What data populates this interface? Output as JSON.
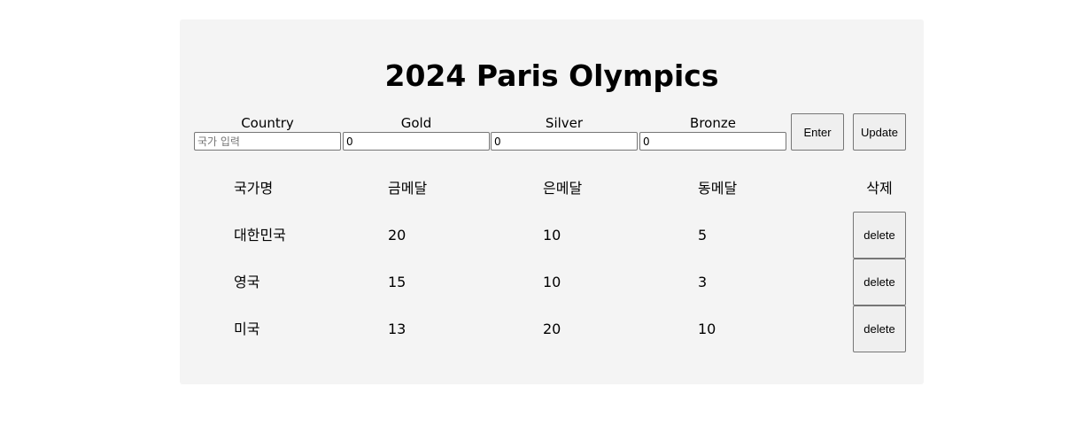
{
  "title": "2024 Paris Olympics",
  "form": {
    "country_label": "Country",
    "country_placeholder": "국가 입력",
    "country_value": "",
    "gold_label": "Gold",
    "gold_value": "0",
    "silver_label": "Silver",
    "silver_value": "0",
    "bronze_label": "Bronze",
    "bronze_value": "0",
    "enter_label": "Enter",
    "update_label": "Update"
  },
  "table": {
    "headers": [
      "국가명",
      "금메달",
      "은메달",
      "동메달",
      "삭제"
    ],
    "rows": [
      {
        "country": "대한민국",
        "gold": "20",
        "silver": "10",
        "bronze": "5",
        "delete_label": "delete"
      },
      {
        "country": "영국",
        "gold": "15",
        "silver": "10",
        "bronze": "3",
        "delete_label": "delete"
      },
      {
        "country": "미국",
        "gold": "13",
        "silver": "20",
        "bronze": "10",
        "delete_label": "delete"
      }
    ]
  }
}
